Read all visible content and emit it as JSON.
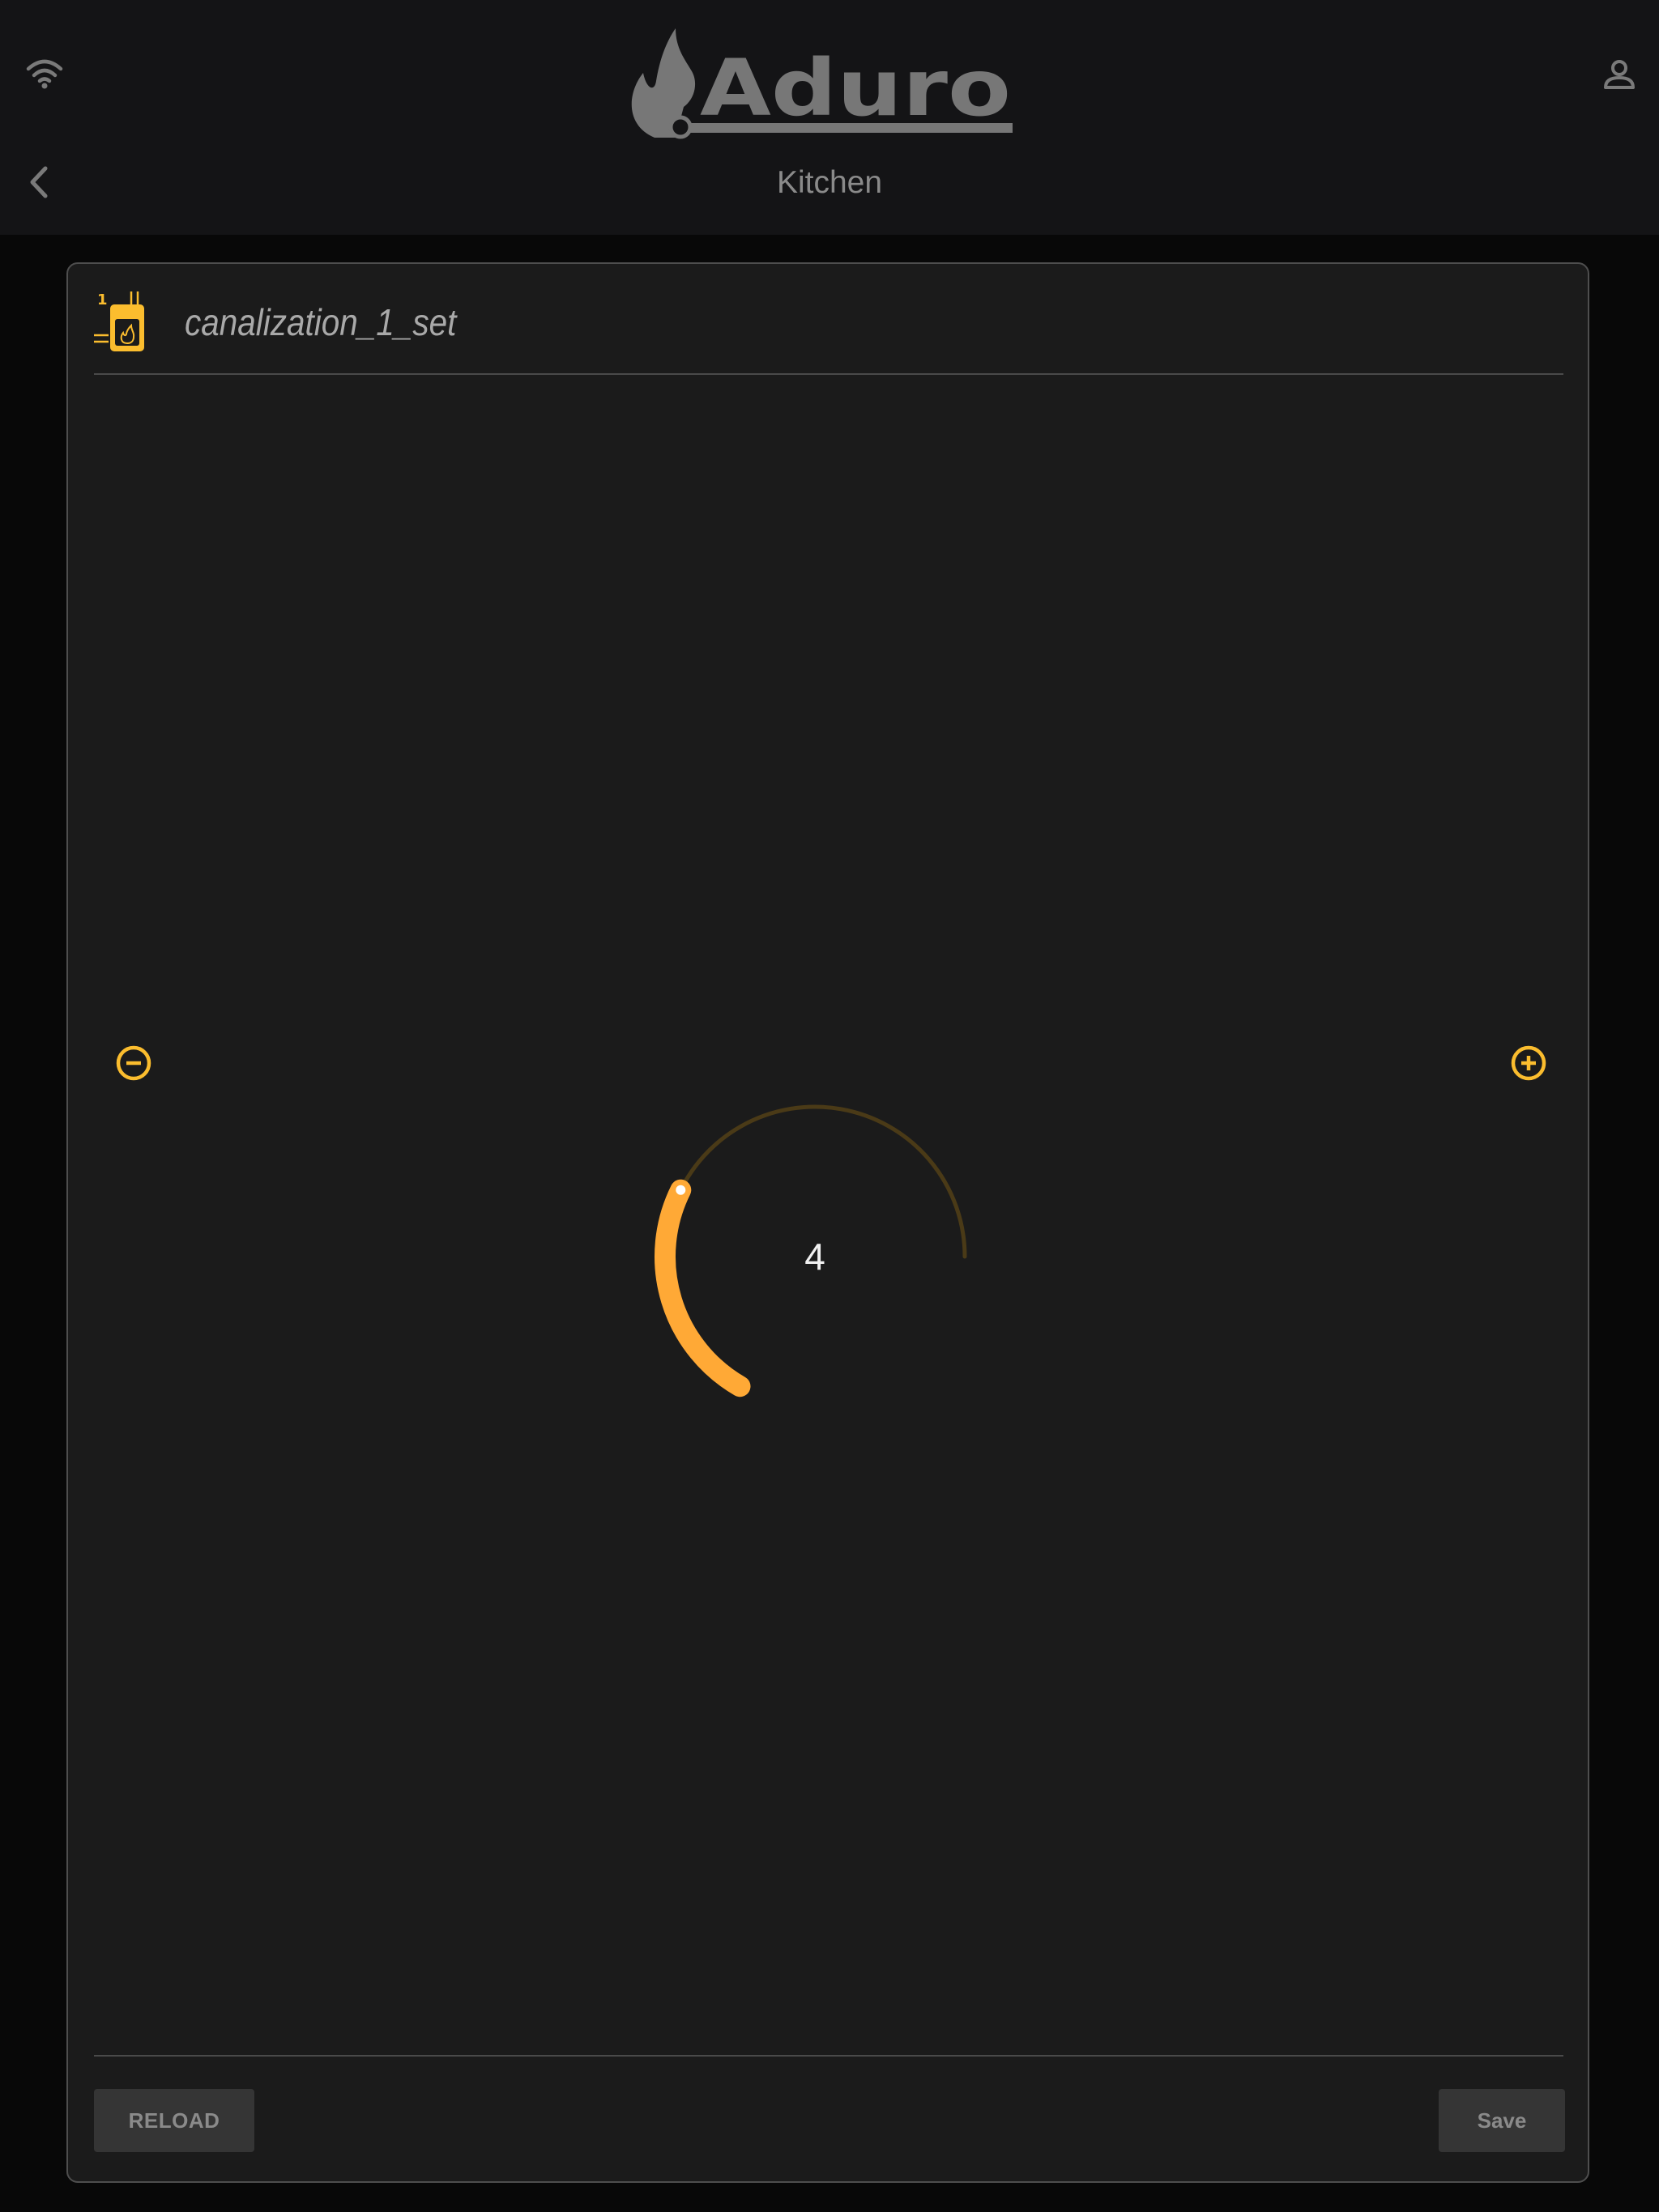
{
  "header": {
    "brand_name": "Aduro",
    "page_title": "Kitchen",
    "icons": {
      "wifi": "wifi-icon",
      "user": "user-icon",
      "back": "chevron-left-icon"
    }
  },
  "card": {
    "title": "canalization_1_set",
    "icon": "stove-channel-icon",
    "icon_badge": "1",
    "controls": {
      "decrease_icon": "minus-circle-icon",
      "increase_icon": "plus-circle-icon"
    },
    "dial": {
      "value": "4",
      "fraction": 0.36
    },
    "buttons": {
      "reload_label": "RELOAD",
      "save_label": "Save"
    }
  },
  "colors": {
    "accent": "#fbbd2e",
    "dial_fill": "#ffa936",
    "dial_track": "#4a3a17",
    "background": "#080808",
    "header": "#141416",
    "card": "#1b1b1b"
  }
}
